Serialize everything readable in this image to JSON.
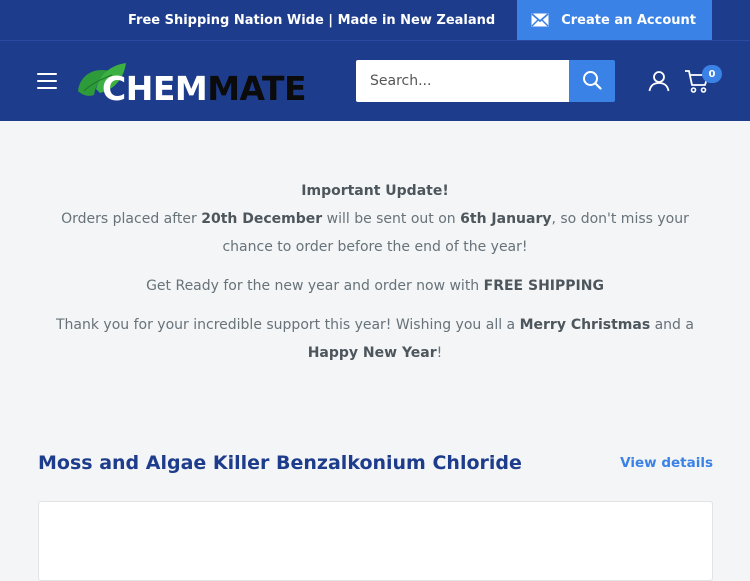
{
  "topbar": {
    "message": "Free Shipping Nation Wide | Made in New Zealand",
    "create_account_label": "Create an Account"
  },
  "header": {
    "logo_part1": "CHEM",
    "logo_part2": "MATE",
    "search_placeholder": "Search...",
    "cart_count": "0"
  },
  "announcement": {
    "title": "Important Update!",
    "line1_before": "Orders placed after ",
    "line1_date1": "20th December",
    "line1_middle": " will be sent out on ",
    "line1_date2": "6th January",
    "line1_after": ", so don't miss your chance to order before the end of the year!",
    "line2_before": "Get Ready for the new year and order now with ",
    "line2_bold": "FREE SHIPPING",
    "line3_before": "Thank you for your incredible support this year! Wishing you all a ",
    "line3_bold1": "Merry Christmas",
    "line3_middle": " and a ",
    "line3_bold2": "Happy New Year",
    "line3_after": "!"
  },
  "featured": {
    "title": "Moss and Algae Killer Benzalkonium Chloride",
    "view_details_label": "View details"
  },
  "colors": {
    "header_bg": "#1e3c8c",
    "accent": "#3b82e6",
    "page_bg": "#f3f5f6"
  }
}
